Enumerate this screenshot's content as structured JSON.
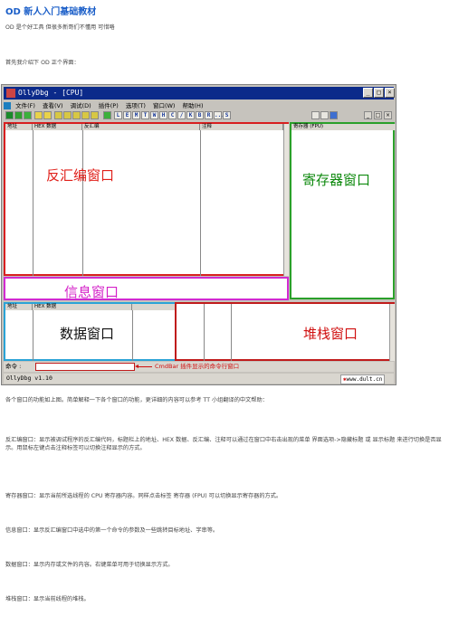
{
  "doc": {
    "title": "OD  新人入门基础教材",
    "line1": "OD  是个好工具  但很多新哥们不懂用  可惜咯",
    "line2": "首先我介绍下  OD 正个界面：",
    "p_intro": "各个窗口的功能如上图。简单解释一下各个窗口的功能，更详细的内容可以参考 TT 小组翻译的中文帮助：",
    "p_disasm": "反汇编窗口：显示被调试程序的反汇编代码，标题栏上的地址、HEX 数据、反汇编、注释可以通过在窗口中右击出现的菜单 界面选项->隐藏标题 或 显示标题 来进行切换是否显示。用鼠标左键点击注释标签可以切换注释显示的方式。",
    "p_reg": "寄存器窗口：显示当前所选线程的 CPU 寄存器内容。同样点击标签 寄存器 (FPU) 可以切换显示寄存器的方式。",
    "p_info": "信息窗口：显示反汇编窗口中选中的第一个命令的参数及一些跳转目标地址、字串等。",
    "p_dump": "数据窗口：显示内存或文件的内容。右键菜单可用于切换显示方式。",
    "p_stack": "堆栈窗口：显示当前线程的堆栈。"
  },
  "olly": {
    "window_title": "OllyDbg - [CPU]",
    "menu": [
      "文件(F)",
      "查看(V)",
      "调试(D)",
      "插件(P)",
      "选项(T)",
      "窗口(W)",
      "帮助(H)"
    ],
    "toolbar_letters": [
      "L",
      "E",
      "M",
      "T",
      "W",
      "H",
      "C",
      "/",
      "K",
      "B",
      "R",
      "...",
      "S"
    ],
    "disasm_headers": {
      "addr": "地址",
      "hex": "HEX 数据",
      "disasm": "反汇编",
      "comment": "注释"
    },
    "reg_header": "寄存器 (FPU)",
    "dump_headers": {
      "addr": "地址",
      "hex": "HEX 数据"
    },
    "cmd_label": "命令 :",
    "annotation": "CmdBar 插件显示的命令行窗口",
    "status_left": "OllyDbg v1.10",
    "status_right": "www.dult.cn",
    "labels": {
      "disasm": "反汇编窗口",
      "reg": "寄存器窗口",
      "info": "信息窗口",
      "dump": "数据窗口",
      "stack": "堆栈窗口"
    }
  },
  "colors": {
    "title": "#1a5ec8",
    "label_disasm": "#e0201a",
    "label_reg": "#0f8a0f",
    "label_info": "#d421c8",
    "label_dump": "#111111",
    "label_stack": "#d01010",
    "border_disasm": "#d81f1f",
    "border_reg": "#2aa02a",
    "border_info": "#d12ad1",
    "border_dump": "#2aa3d6",
    "border_stack": "#c01b1b"
  }
}
